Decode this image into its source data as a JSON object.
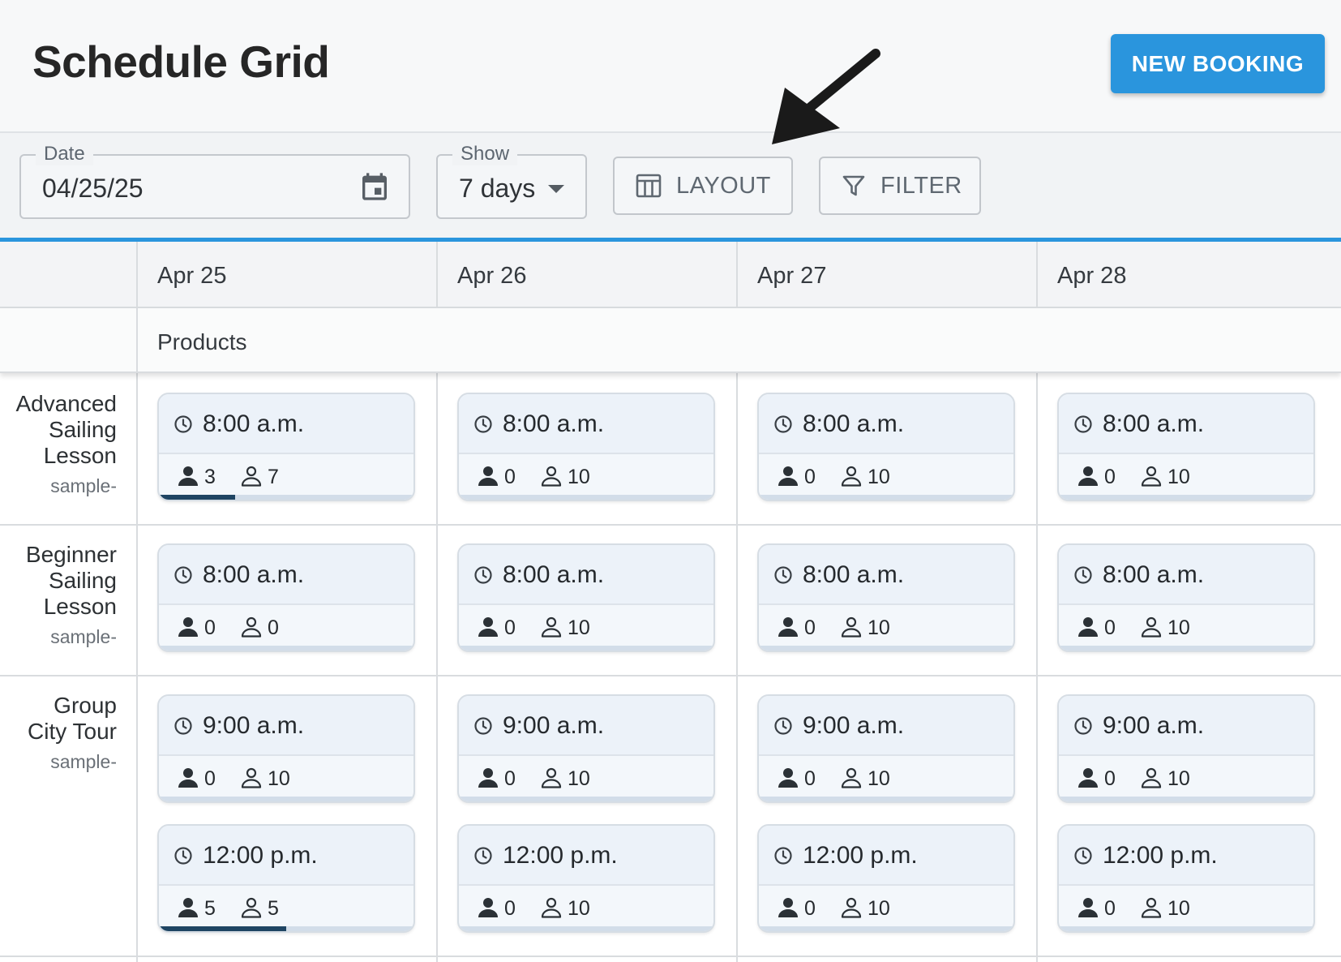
{
  "header": {
    "title": "Schedule Grid",
    "new_booking_label": "NEW BOOKING"
  },
  "toolbar": {
    "date_legend": "Date",
    "date_value": "04/25/25",
    "show_legend": "Show",
    "show_value": "7 days",
    "layout_label": "LAYOUT",
    "filter_label": "FILTER"
  },
  "grid": {
    "days": [
      "Apr 25",
      "Apr 26",
      "Apr 27",
      "Apr 28"
    ],
    "products_label": "Products",
    "rows": [
      {
        "name": "Advanced Sailing Lesson",
        "name_lines": [
          "Advanced",
          "Sailing",
          "Lesson"
        ],
        "code": "sample-",
        "slots": [
          [
            {
              "time": "8:00 a.m.",
              "booked": 3,
              "available": 7,
              "fill": 0.3
            }
          ],
          [
            {
              "time": "8:00 a.m.",
              "booked": 0,
              "available": 10,
              "fill": 0
            }
          ],
          [
            {
              "time": "8:00 a.m.",
              "booked": 0,
              "available": 10,
              "fill": 0
            }
          ],
          [
            {
              "time": "8:00 a.m.",
              "booked": 0,
              "available": 10,
              "fill": 0
            }
          ]
        ]
      },
      {
        "name": "Beginner Sailing Lesson",
        "name_lines": [
          "Beginner",
          "Sailing",
          "Lesson"
        ],
        "code": "sample-",
        "slots": [
          [
            {
              "time": "8:00 a.m.",
              "booked": 0,
              "available": 0,
              "fill": 0
            }
          ],
          [
            {
              "time": "8:00 a.m.",
              "booked": 0,
              "available": 10,
              "fill": 0
            }
          ],
          [
            {
              "time": "8:00 a.m.",
              "booked": 0,
              "available": 10,
              "fill": 0
            }
          ],
          [
            {
              "time": "8:00 a.m.",
              "booked": 0,
              "available": 10,
              "fill": 0
            }
          ]
        ]
      },
      {
        "name": "Group City Tour",
        "name_lines": [
          "Group",
          "City Tour"
        ],
        "code": "sample-",
        "slots": [
          [
            {
              "time": "9:00 a.m.",
              "booked": 0,
              "available": 10,
              "fill": 0
            },
            {
              "time": "12:00 p.m.",
              "booked": 5,
              "available": 5,
              "fill": 0.5
            }
          ],
          [
            {
              "time": "9:00 a.m.",
              "booked": 0,
              "available": 10,
              "fill": 0
            },
            {
              "time": "12:00 p.m.",
              "booked": 0,
              "available": 10,
              "fill": 0
            }
          ],
          [
            {
              "time": "9:00 a.m.",
              "booked": 0,
              "available": 10,
              "fill": 0
            },
            {
              "time": "12:00 p.m.",
              "booked": 0,
              "available": 10,
              "fill": 0
            }
          ],
          [
            {
              "time": "9:00 a.m.",
              "booked": 0,
              "available": 10,
              "fill": 0
            },
            {
              "time": "12:00 p.m.",
              "booked": 0,
              "available": 10,
              "fill": 0
            }
          ]
        ]
      }
    ]
  },
  "icons": {
    "date_field": "calendar-icon",
    "show_field": "caret-down-icon",
    "layout_button": "table-columns-icon",
    "filter_button": "funnel-icon",
    "slot_time": "clock-icon",
    "slot_booked": "person-filled-icon",
    "slot_available": "person-outline-icon",
    "annotation": "arrow-icon"
  },
  "colors": {
    "accent": "#2a95dd",
    "fill_bar": "#1f4563"
  }
}
